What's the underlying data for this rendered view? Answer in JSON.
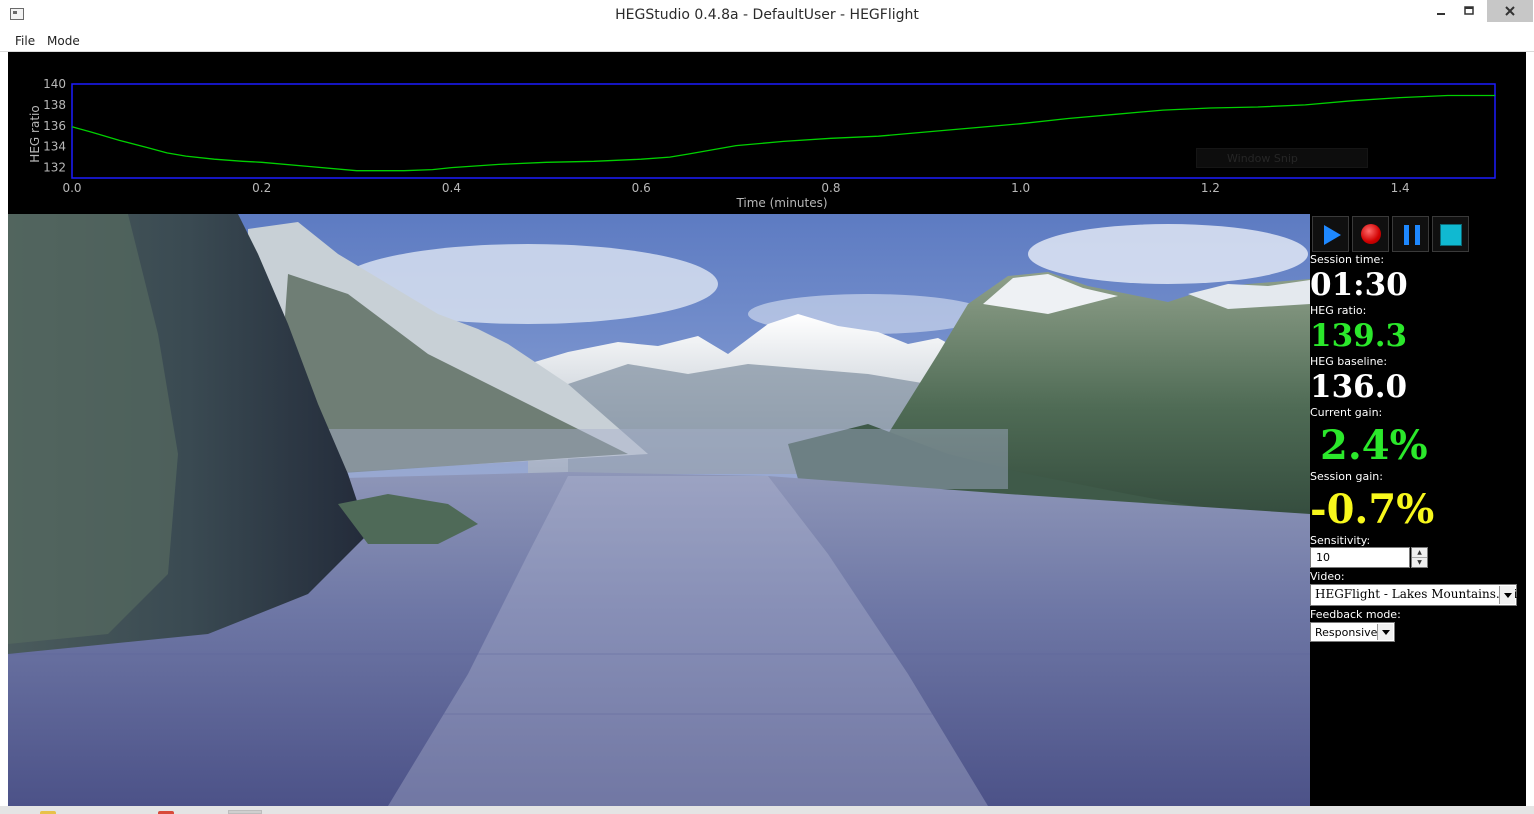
{
  "window": {
    "title": "HEGStudio 0.4.8a - DefaultUser - HEGFlight",
    "minimize_icon": "minimize-icon",
    "maximize_icon": "maximize-icon",
    "close_icon": "close-icon"
  },
  "menu": {
    "items": [
      "File",
      "Mode"
    ]
  },
  "chart_data": {
    "type": "line",
    "title": "",
    "xlabel": "Time (minutes)",
    "ylabel": "HEG ratio",
    "xlim": [
      0.0,
      1.5
    ],
    "ylim": [
      131,
      140
    ],
    "x_ticks": [
      0.0,
      0.2,
      0.4,
      0.6,
      0.8,
      1.0,
      1.2,
      1.4
    ],
    "x_tick_labels": [
      "0.0",
      "0.2",
      "0.4",
      "0.6",
      "0.8",
      "1.0",
      "1.2",
      "1.4"
    ],
    "y_ticks": [
      132,
      134,
      136,
      138,
      140
    ],
    "y_tick_labels": [
      "132",
      "134",
      "136",
      "138",
      "140"
    ],
    "grid": false,
    "legend": "none",
    "background": "#000000",
    "frame_color": "#1c1cff",
    "axis_text_color": "#b8b8b8",
    "series": [
      {
        "color": "#00d000",
        "x": [
          0.0,
          0.02,
          0.05,
          0.08,
          0.1,
          0.12,
          0.15,
          0.18,
          0.2,
          0.25,
          0.3,
          0.35,
          0.38,
          0.4,
          0.45,
          0.5,
          0.55,
          0.6,
          0.63,
          0.65,
          0.7,
          0.75,
          0.8,
          0.85,
          0.9,
          0.95,
          1.0,
          1.05,
          1.1,
          1.15,
          1.2,
          1.25,
          1.3,
          1.35,
          1.4,
          1.45,
          1.5
        ],
        "y": [
          135.9,
          135.4,
          134.6,
          133.9,
          133.4,
          133.1,
          132.8,
          132.6,
          132.5,
          132.1,
          131.7,
          131.7,
          131.8,
          132.0,
          132.3,
          132.5,
          132.6,
          132.8,
          133.0,
          133.3,
          134.1,
          134.5,
          134.8,
          135.0,
          135.4,
          135.8,
          136.2,
          136.7,
          137.1,
          137.5,
          137.7,
          137.8,
          138.0,
          138.4,
          138.7,
          138.9,
          138.9
        ]
      }
    ]
  },
  "chart_overlay": {
    "text": "Window Snip"
  },
  "controls": {
    "play_icon": "play-icon",
    "record_icon": "record-icon",
    "pause_icon": "pause-icon",
    "stop_icon": "stop-icon"
  },
  "stats": {
    "session_time_label": "Session time:",
    "session_time": "01:30",
    "heg_ratio_label": "HEG ratio:",
    "heg_ratio": "139.3",
    "heg_baseline_label": "HEG baseline:",
    "heg_baseline": "136.0",
    "current_gain_label": "Current gain:",
    "current_gain": "2.4%",
    "session_gain_label": "Session gain:",
    "session_gain": "-0.7%",
    "colors": {
      "positive": "#2be82b",
      "negative": "#f7f71c",
      "neutral": "#ffffff"
    }
  },
  "settings": {
    "sensitivity_label": "Sensitivity:",
    "sensitivity_value": "10",
    "video_label": "Video:",
    "video_value": "HEGFlight - Lakes Mountains.avi",
    "feedback_label": "Feedback mode:",
    "feedback_value": "Responsive"
  }
}
